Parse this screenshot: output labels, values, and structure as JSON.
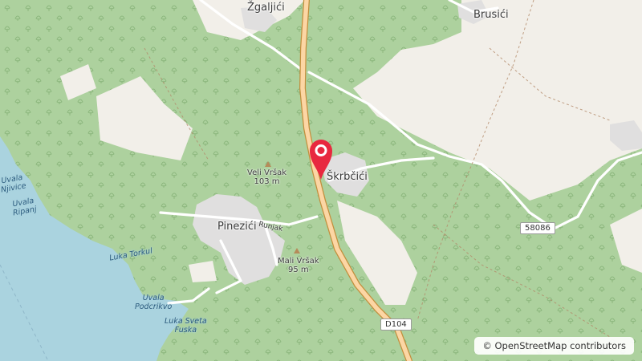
{
  "map": {
    "places": [
      {
        "key": "zgaljici",
        "name": "Žgaljići"
      },
      {
        "key": "brusici",
        "name": "Brusići"
      },
      {
        "key": "skrbcici",
        "name": "Škrbčići"
      },
      {
        "key": "pinezici",
        "name": "Pinezići"
      }
    ],
    "peaks": [
      {
        "name": "Veli Vršak",
        "elevation": "103 m"
      },
      {
        "name": "Mali Vršak",
        "elevation": "95 m"
      }
    ],
    "water_labels": [
      {
        "line1": "Uvala",
        "line2": "Njivice"
      },
      {
        "line1": "Uvala",
        "line2": "Ripanj"
      },
      {
        "line1": "Luka Torkul",
        "line2": ""
      },
      {
        "line1": "Uvala",
        "line2": "Podcrikvo"
      },
      {
        "line1": "Luka Sveta",
        "line2": "Fuska"
      }
    ],
    "streets": [
      {
        "name": "Runjak"
      }
    ],
    "road_refs": [
      {
        "ref": "D104"
      },
      {
        "ref": "58086"
      }
    ],
    "marker": {
      "icon": "map-pin-icon",
      "color": "#e8283f"
    },
    "attribution": {
      "symbol": "©",
      "text": "OpenStreetMap contributors"
    },
    "colors": {
      "land": "#f2efe9",
      "forest": "#add19e",
      "water": "#aad3df",
      "primary_road": "#fcd6a4",
      "primary_casing": "#c28f3d",
      "residential": "#e0dfdf",
      "marker": "#e8283f"
    }
  }
}
